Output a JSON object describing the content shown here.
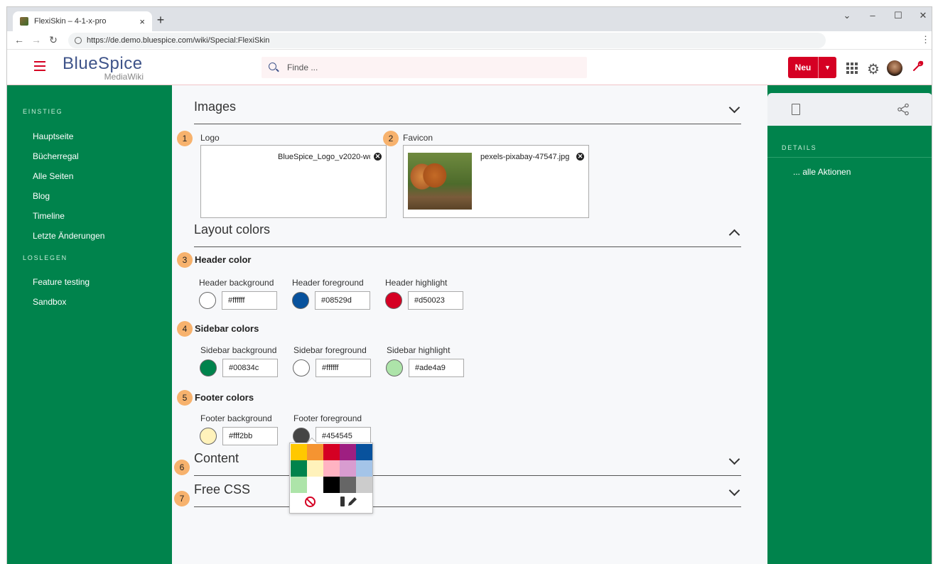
{
  "browser": {
    "tab_title": "FlexiSkin – 4-1-x-pro",
    "tab_close": "×",
    "new_tab": "+",
    "url": "https://de.demo.bluespice.com/wiki/Special:FlexiSkin",
    "window_controls": [
      "⌄",
      "–",
      "☐",
      "✕"
    ]
  },
  "header": {
    "logo_main": "BlueSpice",
    "logo_sub": "MediaWiki",
    "search_placeholder": "Finde ...",
    "new_button": "Neu"
  },
  "left_sidebar": {
    "sections": [
      {
        "heading": "EINSTIEG",
        "items": [
          "Hauptseite",
          "Bücherregal",
          "Alle Seiten",
          "Blog",
          "Timeline",
          "Letzte Änderungen"
        ]
      },
      {
        "heading": "LOSLEGEN",
        "items": [
          "Feature testing",
          "Sandbox"
        ]
      }
    ]
  },
  "right_sidebar": {
    "details_heading": "DETAILS",
    "actions_link": "... alle Aktionen"
  },
  "main": {
    "sections": {
      "images": "Images",
      "layout_colors": "Layout colors",
      "content": "Content",
      "free_css": "Free CSS"
    },
    "badges": [
      "1",
      "2",
      "3",
      "4",
      "5",
      "6",
      "7"
    ],
    "logo_label": "Logo",
    "logo_file": "BlueSpice_Logo_v2020-wo",
    "favicon_label": "Favicon",
    "favicon_file": "pexels-pixabay-47547.jpg",
    "header_color": {
      "title": "Header color",
      "fields": [
        {
          "label": "Header background",
          "value": "#ffffff"
        },
        {
          "label": "Header foreground",
          "value": "#08529d"
        },
        {
          "label": "Header highlight",
          "value": "#d50023"
        }
      ]
    },
    "sidebar_colors": {
      "title": "Sidebar colors",
      "fields": [
        {
          "label": "Sidebar background",
          "value": "#00834c"
        },
        {
          "label": "Sidebar foreground",
          "value": "#ffffff"
        },
        {
          "label": "Sidebar highlight",
          "value": "#ade4a9"
        }
      ]
    },
    "footer_colors": {
      "title": "Footer colors",
      "fields": [
        {
          "label": "Footer background",
          "value": "#fff2bb"
        },
        {
          "label": "Footer foreground",
          "value": "#454545"
        }
      ]
    }
  },
  "color_picker": {
    "palette": [
      "#ffc800",
      "#f59431",
      "#d50023",
      "#9e1f81",
      "#08529d",
      "#00834c",
      "#fff2bb",
      "#ffb3c2",
      "#d89cd0",
      "#a4c4e8",
      "#ade4a9",
      "#ffffff",
      "#000000",
      "#666666",
      "#cccccc"
    ]
  },
  "colors": {
    "accent": "#d50023",
    "sidebar": "#00834c",
    "brand": "#3e5389"
  }
}
